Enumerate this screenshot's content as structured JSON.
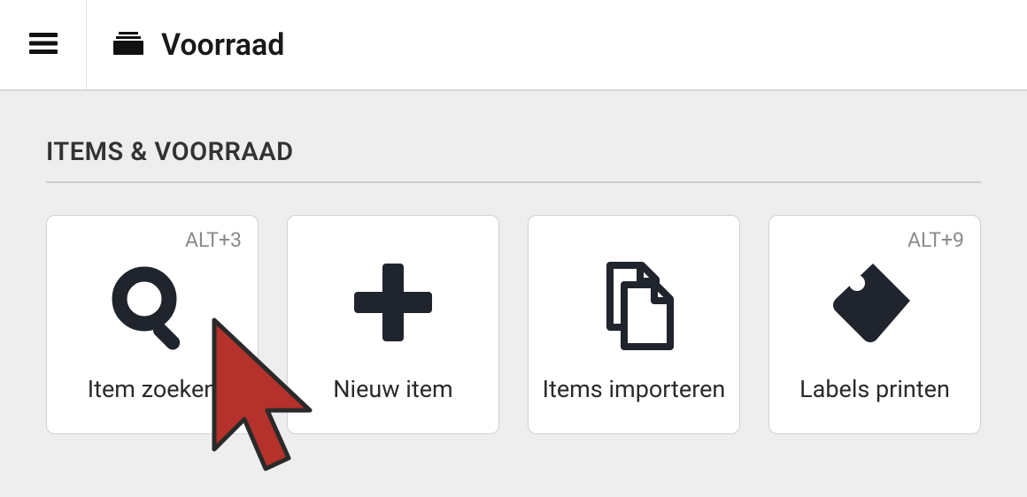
{
  "header": {
    "title": "Voorraad"
  },
  "section": {
    "heading": "ITEMS & VOORRAAD"
  },
  "cards": [
    {
      "label": "Item zoeken",
      "shortcut": "ALT+3",
      "icon": "search"
    },
    {
      "label": "Nieuw item",
      "shortcut": "",
      "icon": "plus"
    },
    {
      "label": "Items importeren",
      "shortcut": "",
      "icon": "documents"
    },
    {
      "label": "Labels printen",
      "shortcut": "ALT+9",
      "icon": "tag"
    }
  ]
}
